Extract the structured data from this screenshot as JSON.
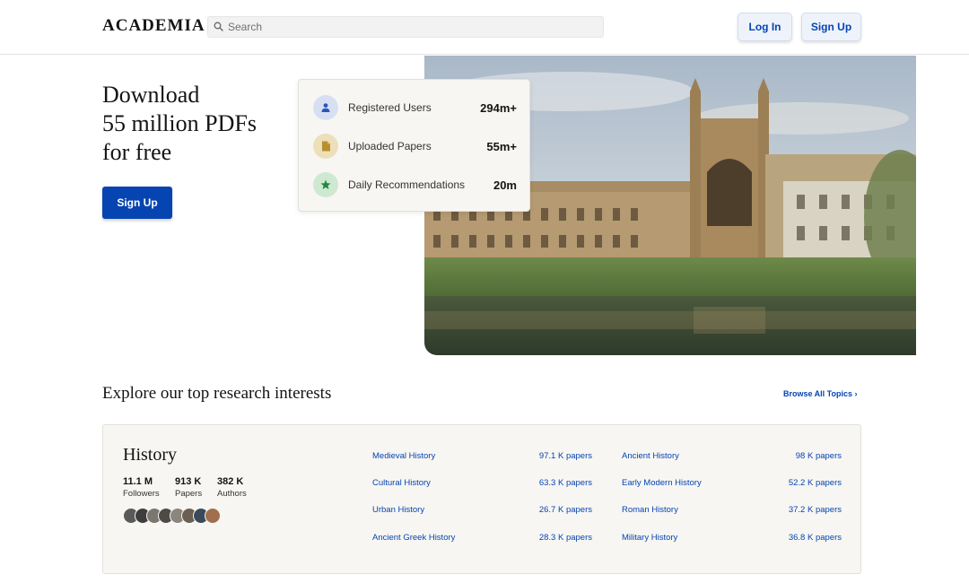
{
  "header": {
    "logo": "ACADEMIA",
    "search_placeholder": "Search",
    "login_label": "Log In",
    "signup_label": "Sign Up"
  },
  "hero": {
    "title_lines": [
      "Download",
      "55 million PDFs",
      "for free"
    ],
    "signup_label": "Sign Up",
    "stats": [
      {
        "label": "Registered Users",
        "value": "294m+",
        "icon": "user-icon",
        "icon_bg": "#d7e0f3",
        "icon_color": "#2a56b5"
      },
      {
        "label": "Uploaded Papers",
        "value": "55m+",
        "icon": "document-icon",
        "icon_bg": "#ecdfba",
        "icon_color": "#b8902b"
      },
      {
        "label": "Daily Recommendations",
        "value": "20m",
        "icon": "star-icon",
        "icon_bg": "#cfe8d2",
        "icon_color": "#1f8a39"
      }
    ]
  },
  "explore": {
    "title": "Explore our top research interests",
    "browse_label": "Browse All Topics ›",
    "topic": {
      "name": "History",
      "stats": [
        {
          "value": "11.1 M",
          "label": "Followers"
        },
        {
          "value": "913 K",
          "label": "Papers"
        },
        {
          "value": "382 K",
          "label": "Authors"
        }
      ],
      "subtopics": [
        {
          "name": "Medieval History",
          "count": "97.1 K papers"
        },
        {
          "name": "Ancient History",
          "count": "98 K papers"
        },
        {
          "name": "Cultural History",
          "count": "63.3 K papers"
        },
        {
          "name": "Early Modern History",
          "count": "52.2 K papers"
        },
        {
          "name": "Urban History",
          "count": "26.7 K papers"
        },
        {
          "name": "Roman History",
          "count": "37.2 K papers"
        },
        {
          "name": "Ancient Greek History",
          "count": "28.3 K papers"
        },
        {
          "name": "Military History",
          "count": "36.8 K papers"
        }
      ]
    }
  },
  "colors": {
    "accent": "#0645b1",
    "card_bg": "#f7f6f3"
  }
}
